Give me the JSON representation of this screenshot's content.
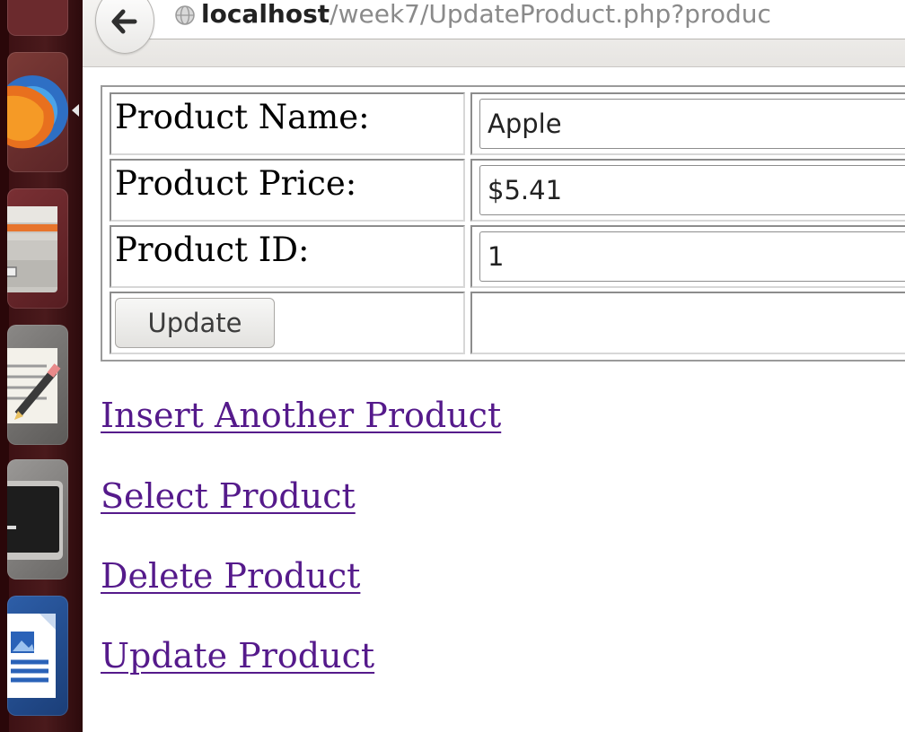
{
  "browser": {
    "url_host": "localhost",
    "url_path": "/week7/UpdateProduct.php?produc"
  },
  "icons": {
    "back": "back-arrow-icon",
    "site": "globe-icon",
    "launcher": [
      "firefox-icon",
      "files-icon",
      "text-editor-icon",
      "terminal-icon",
      "libreoffice-writer-icon"
    ]
  },
  "form": {
    "rows": [
      {
        "label": "Product Name:",
        "value": "Apple"
      },
      {
        "label": "Product Price:",
        "value": "$5.41"
      },
      {
        "label": "Product ID:",
        "value": "1"
      }
    ],
    "submit_label": "Update"
  },
  "links": [
    {
      "label": "Insert Another Product"
    },
    {
      "label": "Select Product"
    },
    {
      "label": "Delete Product"
    },
    {
      "label": "Update Product"
    }
  ],
  "colors": {
    "launcher_bg": "#4a1a1c",
    "visited_link": "#551a8b"
  }
}
